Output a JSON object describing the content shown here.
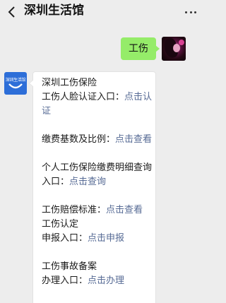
{
  "header": {
    "title": "深圳生活馆"
  },
  "messages": {
    "outgoing": {
      "text": "工伤"
    },
    "bot": {
      "avatar_label": "深圳生活馆",
      "blocks": [
        {
          "lines": [
            {
              "text": "深圳工伤保险"
            }
          ]
        },
        {
          "lines": [
            {
              "text": "工伤人脸认证入口：",
              "link": "点击认证"
            }
          ]
        },
        {
          "lines": [
            {
              "text": "缴费基数及比例：",
              "link": "点击查看"
            }
          ]
        },
        {
          "lines": [
            {
              "text": "个人工伤保险缴费明细查询入口：",
              "link": "点击查询"
            }
          ]
        },
        {
          "lines": [
            {
              "text": "工伤赔偿标准：",
              "link": "点击查看"
            }
          ]
        },
        {
          "lines": [
            {
              "text": "工伤认定"
            }
          ]
        },
        {
          "lines": [
            {
              "text": "申报入口：",
              "link": "点击申报"
            }
          ]
        },
        {
          "lines": [
            {
              "text": "工伤事故备案"
            }
          ]
        },
        {
          "lines": [
            {
              "text": "办理入口：",
              "link": "点击办理"
            }
          ]
        }
      ]
    }
  },
  "icons": {
    "back": "chevron-left-icon",
    "more": "more-dots-icon"
  },
  "colors": {
    "background": "#ededed",
    "outgoing_bubble": "#95ec69",
    "link": "#576b95",
    "bot_avatar": "#2d6ed8"
  }
}
